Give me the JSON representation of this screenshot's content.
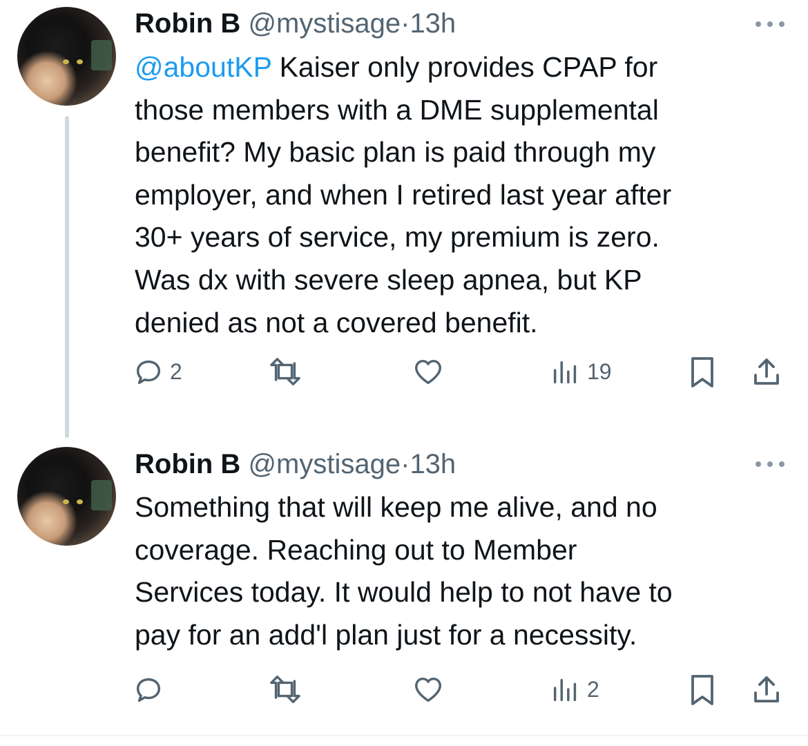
{
  "tweets": [
    {
      "author": {
        "name": "Robin B",
        "handle": "@mystisage",
        "separator": "·",
        "time": "13h"
      },
      "mention": "@aboutKP",
      "lines": [
        " Kaiser only provides CPAP for",
        "those members with a DME supplemental",
        "benefit? My basic plan is paid through my",
        "employer, and when I retired last year after",
        "30+ years of service, my premium is zero.",
        "Was dx with severe sleep apnea, but KP",
        "denied as not a covered benefit."
      ],
      "metrics": {
        "replies": "2",
        "retweets": "",
        "likes": "",
        "views": "19"
      }
    },
    {
      "author": {
        "name": "Robin B",
        "handle": "@mystisage",
        "separator": "·",
        "time": "13h"
      },
      "lines": [
        "Something that will keep me alive, and no",
        "coverage. Reaching out to Member",
        "Services today. It would help to not have to",
        "pay for an add'l plan just for a necessity."
      ],
      "metrics": {
        "replies": "",
        "retweets": "",
        "likes": "",
        "views": "2"
      }
    }
  ],
  "icons": {
    "reply": "reply-icon",
    "retweet": "retweet-icon",
    "like": "heart-icon",
    "views": "views-icon",
    "bookmark": "bookmark-icon",
    "share": "share-icon",
    "more": "more-icon"
  },
  "colors": {
    "text": "#0f1419",
    "secondary": "#536471",
    "link": "#1d9bf0",
    "thread_line": "#cfd9de"
  }
}
